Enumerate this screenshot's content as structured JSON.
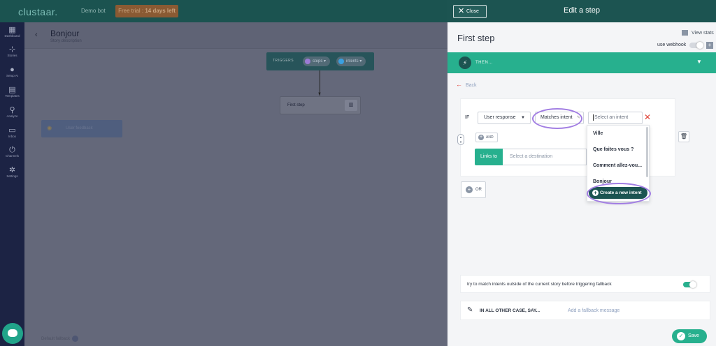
{
  "app": {
    "logo": "clustaar.",
    "bot_name": "Demo bot",
    "trial_prefix": "Free trial :",
    "trial_days": "14 days left"
  },
  "sidebar": {
    "items": [
      {
        "label": "Dashboard",
        "icon": "dashboard-icon"
      },
      {
        "label": "Stories",
        "icon": "stories-icon"
      },
      {
        "label": "Setup AI",
        "icon": "ai-head-icon"
      },
      {
        "label": "Templates",
        "icon": "templates-icon"
      },
      {
        "label": "Analyze",
        "icon": "analyze-icon"
      },
      {
        "label": "Inbox",
        "icon": "inbox-icon"
      },
      {
        "label": "Channels",
        "icon": "channels-icon"
      },
      {
        "label": "Settings",
        "icon": "settings-icon"
      }
    ]
  },
  "story": {
    "title": "Bonjour",
    "description": "Story description",
    "triggers_label": "TRIGGERS",
    "trigger_pills": [
      {
        "label": "steps",
        "color": "#9b7bd6"
      },
      {
        "label": "intents",
        "color": "#3aa0e0"
      }
    ],
    "first_step_label": "First step",
    "fallback_label": "User feedback",
    "bottom_label": "Default fallback"
  },
  "panel": {
    "close_label": "Close",
    "title": "Edit a step",
    "step_name": "First step",
    "view_stats": "View stats",
    "webhook_label": "use webhook",
    "then_label": "THEN...",
    "back_label": "Back",
    "condition": {
      "if_label": "IF",
      "subject": "User response",
      "operator": "Matches intent",
      "intent_placeholder": "Select an intent",
      "and_label": "AND",
      "links_to_label": "Links to",
      "destination_placeholder": "Select a destination"
    },
    "or_label": "OR",
    "intent_options": [
      "Ville",
      "Que faites vous ?",
      "Comment allez-vou...",
      "Bonjour"
    ],
    "create_intent_label": "Create a new intent",
    "fallback_text": "try to match intents outside of the current story before triggering fallback",
    "fallback_toggle_on": true,
    "other_case_label": "IN ALL OTHER CASE, SAY...",
    "add_fallback_label": "Add a fallback message",
    "save_label": "Save"
  },
  "colors": {
    "accent": "#27b08e",
    "dark_teal": "#1c5451",
    "highlight": "#a27ee3",
    "danger": "#e0453a"
  }
}
